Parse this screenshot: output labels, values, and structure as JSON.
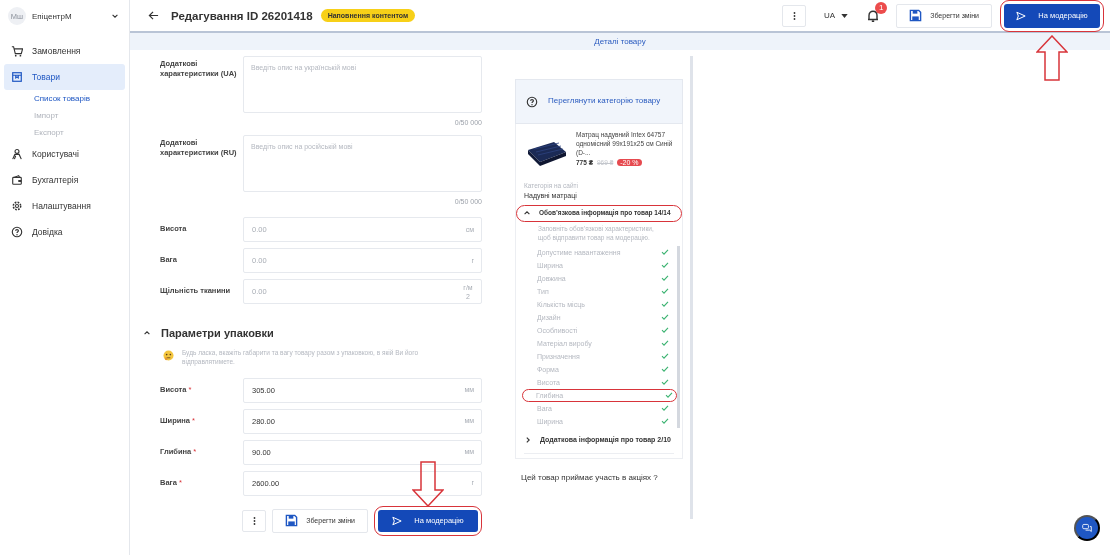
{
  "sidebar": {
    "avatar_text": "Мш",
    "org_name": "ЕпіцентрМ",
    "items": [
      {
        "label": "Замовлення",
        "kind": "cart",
        "selected": false
      },
      {
        "label": "Товари",
        "kind": "box",
        "selected": true,
        "children": [
          {
            "label": "Список товарів",
            "selected": true
          },
          {
            "label": "Імпорт",
            "selected": false
          },
          {
            "label": "Експорт",
            "selected": false
          }
        ]
      },
      {
        "label": "Користувачі",
        "kind": "users",
        "selected": false
      },
      {
        "label": "Бухгалтерія",
        "kind": "wallet",
        "selected": false
      },
      {
        "label": "Налаштування",
        "kind": "gear",
        "selected": false
      },
      {
        "label": "Довідка",
        "kind": "help",
        "selected": false
      }
    ]
  },
  "header": {
    "title": "Редагування ID 26201418",
    "status_badge": "Наповнення контентом",
    "language": "UA",
    "notification_count": "1",
    "save_button": "Зберегти зміни",
    "submit_button": {
      "label": "На модерацію",
      "highlighted": true,
      "pointer_arrow": true
    }
  },
  "tabs": [
    {
      "label": "Деталі товару",
      "selected": true
    }
  ],
  "form": {
    "text_areas": [
      {
        "label": "Додаткові характеристики (UA)",
        "placeholder": "Введіть опис на українській мові",
        "counter": "0/50 000"
      },
      {
        "label": "Додаткові характеристики (RU)",
        "placeholder": "Введіть опис на російській мові",
        "counter": "0/50 000"
      }
    ],
    "fields": [
      {
        "label": "Висота",
        "placeholder": "0.00",
        "unit": "см"
      },
      {
        "label": "Вага",
        "placeholder": "0.00",
        "unit": "г"
      },
      {
        "label": "Щільність тканини",
        "placeholder": "0.00",
        "unit": "г/м2"
      }
    ],
    "packaging": {
      "title": "Параметри упаковки",
      "expanded": true,
      "notice": "Будь ласка, вкажіть габарити та вагу товару разом з упаковкою, в якій Ви його відправлятимете.",
      "fields": [
        {
          "label": "Висота",
          "required_mark": "*",
          "value": "305.00",
          "unit": "мм"
        },
        {
          "label": "Ширина",
          "required_mark": "*",
          "value": "280.00",
          "unit": "мм"
        },
        {
          "label": "Глибина",
          "required_mark": "*",
          "value": "90.00",
          "unit": "мм"
        },
        {
          "label": "Вага",
          "required_mark": "*",
          "value": "2600.00",
          "unit": "г"
        }
      ]
    },
    "footer": {
      "save_button": "Зберегти зміни",
      "submit_button": {
        "label": "На модерацію",
        "highlighted": true,
        "pointer_arrow": true
      }
    }
  },
  "right_panel": {
    "category_link": "Переглянути категорію товару",
    "product": {
      "name": "Матрац надувний Intex 64757 одномісний 99x191x25 см Синій (D-...",
      "price": "775 ₴",
      "old_price": "969 ₴",
      "discount": "-20 %"
    },
    "category_label": "Категорія на сайті",
    "category": "Надувні матраці",
    "required_section": {
      "title": "Обов’язкова інформація про товар 14/14",
      "expanded": true,
      "highlighted": true,
      "hint": "Заповніть обов’язкові характеристики, щоб відправити товар на модерацію.",
      "items": [
        {
          "label": "Допустиме навантаження",
          "done": true,
          "highlighted": false
        },
        {
          "label": "Ширина",
          "done": true,
          "highlighted": false
        },
        {
          "label": "Довжина",
          "done": true,
          "highlighted": false
        },
        {
          "label": "Тип",
          "done": true,
          "highlighted": false
        },
        {
          "label": "Кількість місць",
          "done": true,
          "highlighted": false
        },
        {
          "label": "Дизайн",
          "done": true,
          "highlighted": false
        },
        {
          "label": "Особливості",
          "done": true,
          "highlighted": false
        },
        {
          "label": "Матеріал виробу",
          "done": true,
          "highlighted": false
        },
        {
          "label": "Призначення",
          "done": true,
          "highlighted": false
        },
        {
          "label": "Форма",
          "done": true,
          "highlighted": false
        },
        {
          "label": "Висота",
          "done": true,
          "highlighted": false
        },
        {
          "label": "Глибина",
          "done": true,
          "highlighted": true
        },
        {
          "label": "Вага",
          "done": true,
          "highlighted": false
        },
        {
          "label": "Ширина",
          "done": true,
          "highlighted": false
        }
      ]
    },
    "optional_section": {
      "title": "Додаткова інформація про товар 2/10",
      "expanded": false
    },
    "promo_question": "Цей товар приймає участь в акціях ?"
  }
}
